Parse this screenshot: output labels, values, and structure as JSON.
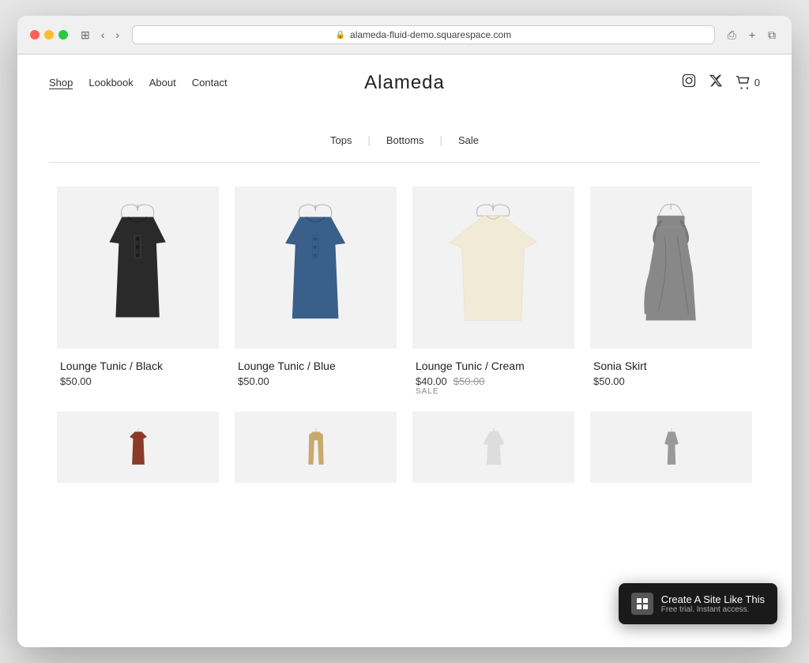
{
  "browser": {
    "url": "alameda-fluid-demo.squarespace.com",
    "back_label": "‹",
    "forward_label": "›",
    "refresh_label": "↺",
    "share_label": "⎙",
    "new_tab_label": "+",
    "windows_label": "⧉"
  },
  "header": {
    "site_title": "Alameda",
    "nav": [
      {
        "label": "Shop",
        "active": true
      },
      {
        "label": "Lookbook",
        "active": false
      },
      {
        "label": "About",
        "active": false
      },
      {
        "label": "Contact",
        "active": false
      }
    ],
    "social": [
      {
        "label": "Instagram",
        "icon": "📷"
      },
      {
        "label": "Twitter",
        "icon": "𝕏"
      }
    ],
    "cart_label": "0"
  },
  "filters": {
    "items": [
      {
        "label": "Tops"
      },
      {
        "label": "Bottoms"
      },
      {
        "label": "Sale"
      }
    ]
  },
  "products": [
    {
      "name": "Lounge Tunic / Black",
      "price": "$50.00",
      "original_price": null,
      "on_sale": false,
      "color": "#2a2a2a",
      "style": "tunic"
    },
    {
      "name": "Lounge Tunic / Blue",
      "price": "$50.00",
      "original_price": null,
      "on_sale": false,
      "color": "#3a5f8a",
      "style": "tunic"
    },
    {
      "name": "Lounge Tunic / Cream",
      "price": "$40.00",
      "original_price": "$50.00",
      "on_sale": true,
      "color": "#f0ead6",
      "style": "tunic-wide"
    },
    {
      "name": "Sonia Skirt",
      "price": "$50.00",
      "original_price": null,
      "on_sale": false,
      "color": "#888",
      "style": "skirt"
    }
  ],
  "bottom_products": [
    {
      "color": "#8b3a2a",
      "style": "vest"
    },
    {
      "color": "#c8a96e",
      "style": "pants"
    },
    {
      "color": "#ddd",
      "style": "top"
    },
    {
      "color": "#888",
      "style": "other"
    }
  ],
  "banner": {
    "title": "Create A Site Like This",
    "subtitle": "Free trial. Instant access."
  }
}
